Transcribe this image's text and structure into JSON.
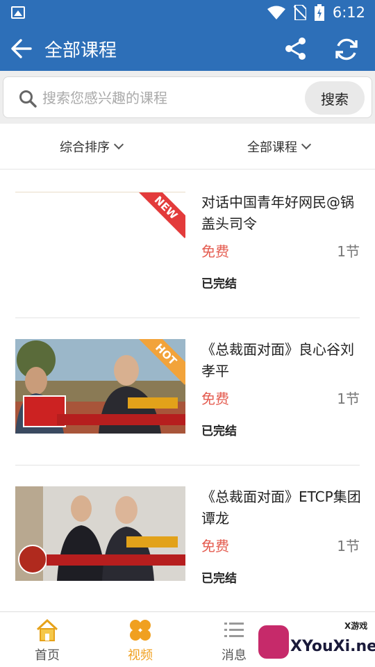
{
  "status_bar": {
    "time": "6:12"
  },
  "app_bar": {
    "title": "全部课程",
    "icons": [
      "back-arrow-icon",
      "share-icon",
      "refresh-icon"
    ]
  },
  "search": {
    "placeholder": "搜索您感兴趣的课程",
    "button_label": "搜索"
  },
  "filters": [
    {
      "label": "综合排序"
    },
    {
      "label": "全部课程"
    }
  ],
  "courses": [
    {
      "badge": "NEW",
      "title": "对话中国青年好网民@锅盖头司令",
      "price": "免费",
      "lessons": "1节",
      "status": "已完结"
    },
    {
      "badge": "HOT",
      "title": "《总裁面对面》良心谷刘孝平",
      "price": "免费",
      "lessons": "1节",
      "status": "已完结"
    },
    {
      "badge": "",
      "title": "《总裁面对面》ETCP集团谭龙",
      "price": "免费",
      "lessons": "1节",
      "status": "已完结"
    }
  ],
  "tabs": [
    {
      "label": "首页",
      "icon": "home-icon"
    },
    {
      "label": "视频",
      "icon": "video-icon",
      "active": true
    },
    {
      "label": "消息",
      "icon": "list-icon"
    }
  ],
  "watermark": {
    "top": "X游戏",
    "main": "XYouXi.net"
  },
  "colors": {
    "primary": "#2d6fb8",
    "accent": "#f0a020",
    "price": "#e45c50",
    "new_badge": "#e33b3b",
    "hot_badge": "#f2a33a"
  }
}
